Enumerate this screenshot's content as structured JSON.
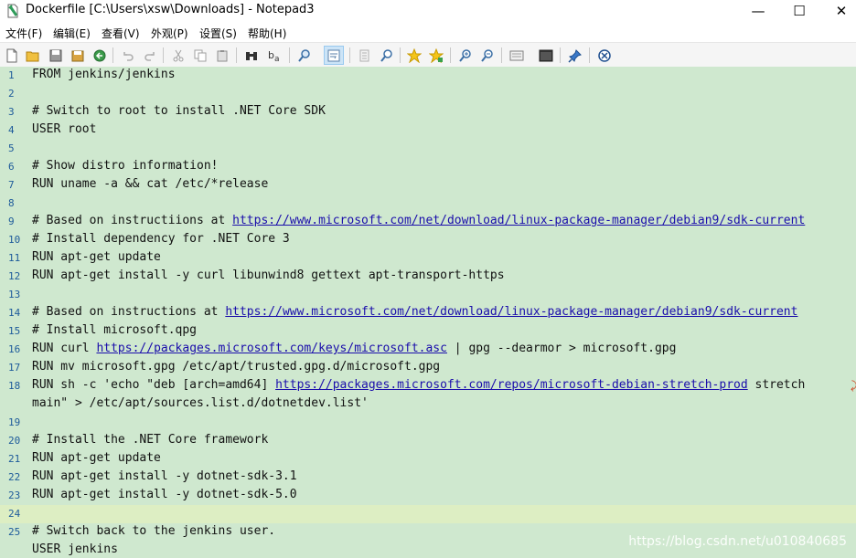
{
  "window": {
    "title": "Dockerfile [C:\\Users\\xsw\\Downloads] - Notepad3",
    "minimize_glyph": "—",
    "maximize_glyph": "☐",
    "close_glyph": "✕"
  },
  "menu": [
    "文件(F)",
    "编辑(E)",
    "查看(V)",
    "外观(P)",
    "设置(S)",
    "帮助(H)"
  ],
  "toolbar": {
    "icons": [
      "new-file-icon",
      "open-folder-icon",
      "save-icon",
      "save-as-icon",
      "revert-icon",
      "undo-icon",
      "redo-icon",
      "cut-icon",
      "copy-icon",
      "paste-icon",
      "find-icon",
      "replace-icon",
      "find-in-files-icon",
      "word-wrap-icon",
      "copy-all-icon",
      "zoom-find-icon",
      "favorite-icon",
      "add-favorite-icon",
      "zoom-in-icon",
      "zoom-out-icon",
      "scheme-icon",
      "terminal-icon",
      "pin-icon",
      "exit-icon"
    ],
    "active_icon": "word-wrap-icon"
  },
  "editor": {
    "current_line": 24,
    "lines": [
      {
        "n": "1",
        "segs": [
          {
            "t": "FROM jenkins/jenkins"
          }
        ]
      },
      {
        "n": "2",
        "segs": []
      },
      {
        "n": "3",
        "segs": [
          {
            "t": "# Switch to root to install .NET Core SDK"
          }
        ]
      },
      {
        "n": "4",
        "segs": [
          {
            "t": "USER root"
          }
        ]
      },
      {
        "n": "5",
        "segs": []
      },
      {
        "n": "6",
        "segs": [
          {
            "t": "# Show distro information!"
          }
        ]
      },
      {
        "n": "7",
        "segs": [
          {
            "t": "RUN uname -a && cat /etc/*release"
          }
        ]
      },
      {
        "n": "8",
        "segs": []
      },
      {
        "n": "9",
        "segs": [
          {
            "t": "# Based on instructiions at "
          },
          {
            "t": "https://www.microsoft.com/net/download/linux-package-manager/debian9/sdk-current",
            "url": true
          }
        ]
      },
      {
        "n": "10",
        "segs": [
          {
            "t": "# Install dependency for .NET Core 3"
          }
        ]
      },
      {
        "n": "11",
        "segs": [
          {
            "t": "RUN apt-get update"
          }
        ]
      },
      {
        "n": "12",
        "segs": [
          {
            "t": "RUN apt-get install -y curl libunwind8 gettext apt-transport-https"
          }
        ]
      },
      {
        "n": "13",
        "segs": []
      },
      {
        "n": "14",
        "segs": [
          {
            "t": "# Based on instructions at "
          },
          {
            "t": "https://www.microsoft.com/net/download/linux-package-manager/debian9/sdk-current",
            "url": true
          }
        ]
      },
      {
        "n": "15",
        "segs": [
          {
            "t": "# Install microsoft.qpg"
          }
        ]
      },
      {
        "n": "16",
        "segs": [
          {
            "t": "RUN curl "
          },
          {
            "t": "https://packages.microsoft.com/keys/microsoft.asc",
            "url": true
          },
          {
            "t": " | gpg --dearmor > microsoft.gpg"
          }
        ]
      },
      {
        "n": "17",
        "segs": [
          {
            "t": "RUN mv microsoft.gpg /etc/apt/trusted.gpg.d/microsoft.gpg"
          }
        ]
      },
      {
        "n": "18",
        "segs": [
          {
            "t": "RUN sh -c 'echo \"deb [arch=amd64] "
          },
          {
            "t": "https://packages.microsoft.com/repos/microsoft-debian-stretch-prod",
            "url": true
          },
          {
            "t": " stretch"
          }
        ],
        "wrap": true
      },
      {
        "n": "",
        "segs": [
          {
            "t": "main\" > /etc/apt/sources.list.d/dotnetdev.list'"
          }
        ]
      },
      {
        "n": "19",
        "segs": []
      },
      {
        "n": "20",
        "segs": [
          {
            "t": "# Install the .NET Core framework"
          }
        ]
      },
      {
        "n": "21",
        "segs": [
          {
            "t": "RUN apt-get update"
          }
        ]
      },
      {
        "n": "22",
        "segs": [
          {
            "t": "RUN apt-get install -y dotnet-sdk-3.1"
          }
        ]
      },
      {
        "n": "23",
        "segs": [
          {
            "t": "RUN apt-get install -y dotnet-sdk-5.0"
          }
        ]
      },
      {
        "n": "24",
        "segs": []
      },
      {
        "n": "25",
        "segs": [
          {
            "t": "# Switch back to the jenkins user."
          }
        ]
      },
      {
        "n": "",
        "segs": [
          {
            "t": "USER jenkins"
          }
        ]
      }
    ]
  },
  "wrap_marker": "⤸",
  "watermark": "https://blog.csdn.net/u010840685",
  "colors": {
    "editor_bg": "#cfe8cf",
    "current_line_bg": "#ddeec3",
    "line_number": "#1d5a9a",
    "link": "#1a0dab"
  }
}
